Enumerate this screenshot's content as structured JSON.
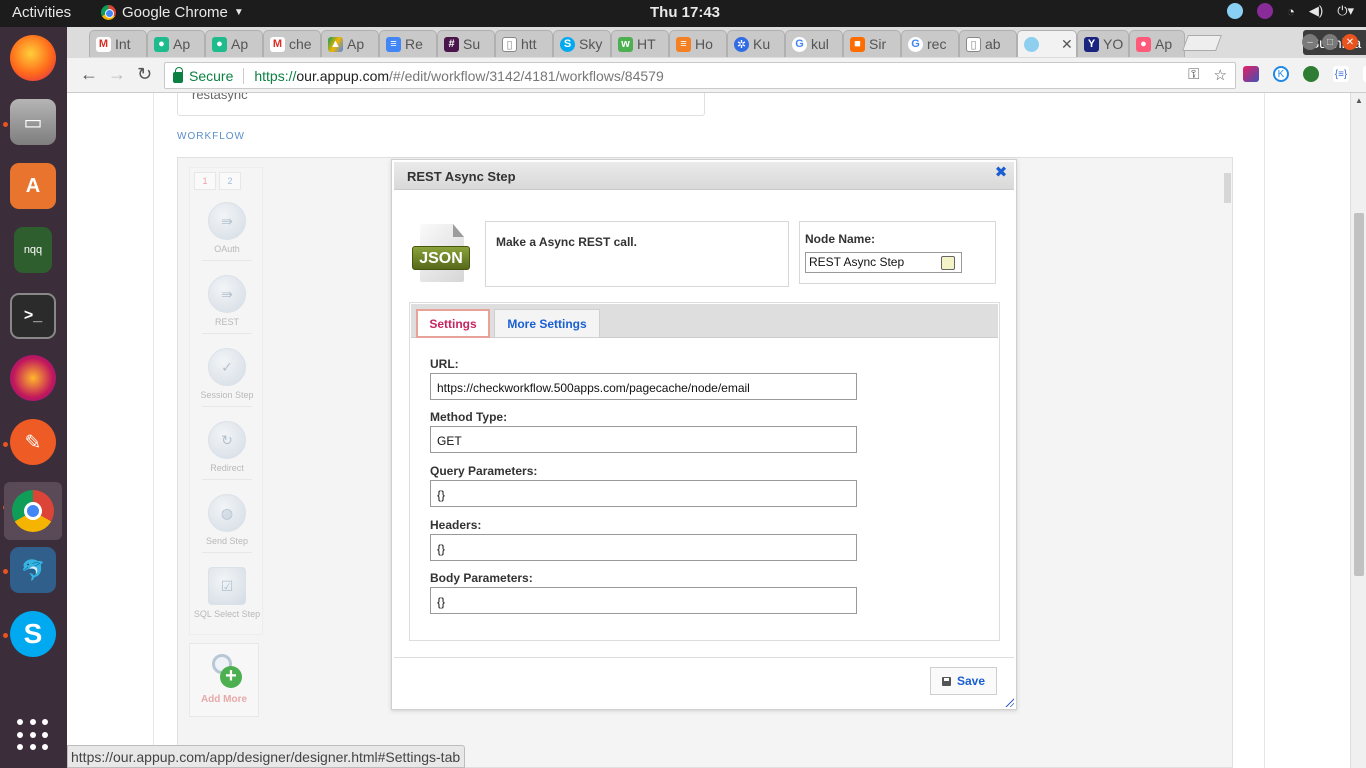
{
  "system_bar": {
    "activities": "Activities",
    "app_name": "Google Chrome",
    "clock": "Thu 17:43"
  },
  "dock": {
    "items": [
      "firefox-icon",
      "files-icon",
      "software-center-icon",
      "nqq-icon",
      "terminal-icon",
      "flame-icon",
      "postman-icon",
      "chrome-icon",
      "mysql-workbench-icon",
      "skype-icon",
      "show-apps-icon"
    ],
    "nqq_label": "nqq"
  },
  "browser": {
    "tabs": [
      {
        "label": "Int",
        "icon": "gmail-icon"
      },
      {
        "label": "Ap",
        "icon": "appup-icon"
      },
      {
        "label": "Ap",
        "icon": "appup-icon"
      },
      {
        "label": "che",
        "icon": "gmail-icon"
      },
      {
        "label": "Ap",
        "icon": "drive-icon"
      },
      {
        "label": "Re",
        "icon": "docs-icon"
      },
      {
        "label": "Su",
        "icon": "slack-icon"
      },
      {
        "label": "htt",
        "icon": "page-icon"
      },
      {
        "label": "Sky",
        "icon": "skype-icon"
      },
      {
        "label": "HT",
        "icon": "html-icon"
      },
      {
        "label": "Ho",
        "icon": "stackoverflow-icon"
      },
      {
        "label": "Ku",
        "icon": "kubernetes-icon"
      },
      {
        "label": "kul",
        "icon": "google-icon"
      },
      {
        "label": "Sir",
        "icon": "box-icon"
      },
      {
        "label": "rec",
        "icon": "google-icon"
      },
      {
        "label": "ab",
        "icon": "page-icon"
      },
      {
        "label": "",
        "icon": "cloud-icon",
        "active": true
      },
      {
        "label": "YO",
        "icon": "ycombinator-icon"
      },
      {
        "label": "Ap",
        "icon": "appup-red-icon"
      }
    ],
    "user_name": "Suchitra",
    "secure_label": "Secure",
    "url_scheme": "https://",
    "url_host": "our.appup.com",
    "url_path": "/#/edit/workflow/3142/4181/workflows/84579",
    "status_url": "https://our.appup.com/app/designer/designer.html#Settings-tab"
  },
  "page": {
    "top_card_text": "restasync",
    "section_label": "WORKFLOW",
    "palette": {
      "tab1": "1",
      "tab2": "2",
      "items": [
        "OAuth",
        "REST",
        "Session Step",
        "Redirect",
        "Send Step",
        "SQL Select Step"
      ],
      "add_more": "Add More"
    },
    "dialog": {
      "title": "REST Async Step",
      "close_glyph": "✖",
      "icon_label": "JSON",
      "description": "Make a Async REST call.",
      "node_name_label": "Node Name:",
      "node_name_value": "REST Async Step",
      "tabs": {
        "settings": "Settings",
        "more_settings": "More Settings"
      },
      "fields": [
        {
          "label": "URL:",
          "value": "https://checkworkflow.500apps.com/pagecache/node/email"
        },
        {
          "label": "Method Type:",
          "value": "GET"
        },
        {
          "label": "Query Parameters:",
          "value": "{}"
        },
        {
          "label": "Headers:",
          "value": "{}"
        },
        {
          "label": "Body Parameters:",
          "value": "{}"
        }
      ],
      "save_label": "Save"
    }
  },
  "colors": {
    "accent_blue": "#1a5fd1",
    "settings_tab_pink": "#c7255f",
    "secure_green": "#0b8043",
    "dock_bg": "#3b2d39"
  }
}
